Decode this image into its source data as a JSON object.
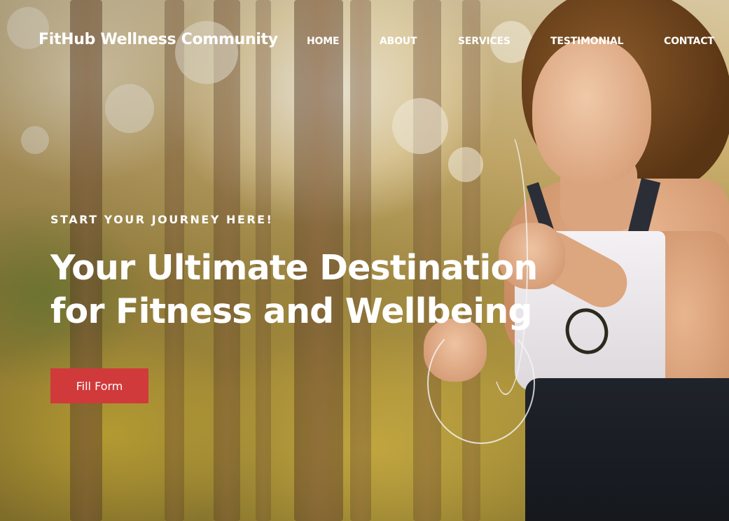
{
  "header": {
    "brand": "FitHub Wellness Community",
    "nav": {
      "home": "HOME",
      "about": "ABOUT",
      "services": "SERVICES",
      "testimonial": "TESTIMONIAL",
      "contact": "CONTACT"
    }
  },
  "hero": {
    "eyebrow": "START YOUR JOURNEY HERE!",
    "headline_line1": "Your Ultimate Destination",
    "headline_line2": "for Fitness and Wellbeing",
    "cta_label": "Fill Form",
    "background_image": "woman-running-in-sunlit-forest-photo"
  },
  "colors": {
    "cta_background": "#d13a3a",
    "text": "#ffffff"
  }
}
